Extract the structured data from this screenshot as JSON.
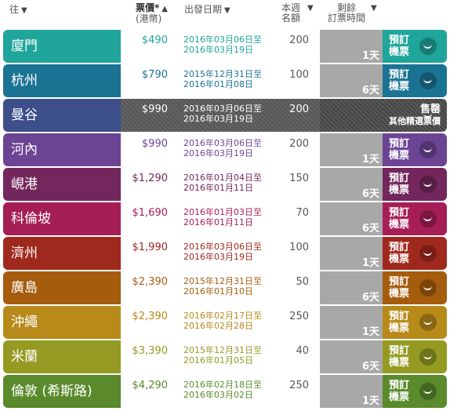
{
  "header": {
    "dest": "往",
    "price_main": "票價*",
    "price_sub": "(港幣)",
    "date": "出發日期",
    "quota_l1": "本週",
    "quota_l2": "名額",
    "remain_l1": "剩餘",
    "remain_l2": "訂票時間",
    "sort_desc": "▼",
    "sort_asc": "▲"
  },
  "rows": [
    {
      "city": "廈門",
      "price": "$490",
      "date1": "2016年03月06日至",
      "date2": "2016年03月19日",
      "quota": "200",
      "days": "1天",
      "book": "預訂機票",
      "color": "#1fa59a",
      "textcolor": "#1fa59a"
    },
    {
      "city": "杭州",
      "price": "$790",
      "date1": "2015年12月31日至",
      "date2": "2016年01月08日",
      "quota": "100",
      "days": "6天",
      "book": "預訂機票",
      "color": "#1b7393",
      "textcolor": "#1b7393"
    },
    {
      "city": "曼谷",
      "price": "$990",
      "date1": "2016年03月06日至",
      "date2": "2016年03月19日",
      "quota": "200",
      "days": "",
      "book": "售罄",
      "book2": "其他精選票價",
      "color": "#3d4f8a",
      "textcolor": "#ffffff"
    },
    {
      "city": "河內",
      "price": "$990",
      "date1": "2016年03月06日至",
      "date2": "2016年03月19日",
      "quota": "200",
      "days": "1天",
      "book": "預訂機票",
      "color": "#6b4494",
      "textcolor": "#6b4494"
    },
    {
      "city": "峴港",
      "price": "$1,290",
      "date1": "2016年01月04日至",
      "date2": "2016年01月11日",
      "quota": "150",
      "days": "6天",
      "book": "預訂機票",
      "color": "#73275c",
      "textcolor": "#73275c"
    },
    {
      "city": "科倫坡",
      "price": "$1,690",
      "date1": "2016年01月03日至",
      "date2": "2016年01月11日",
      "quota": "70",
      "days": "6天",
      "book": "預訂機票",
      "color": "#a61e56",
      "textcolor": "#a61e56"
    },
    {
      "city": "濟州",
      "price": "$1,990",
      "date1": "2016年03月06日至",
      "date2": "2016年03月19日",
      "quota": "100",
      "days": "1天",
      "book": "預訂機票",
      "color": "#a0291e",
      "textcolor": "#a0291e"
    },
    {
      "city": "廣島",
      "price": "$2,390",
      "date1": "2015年12月31日至",
      "date2": "2016年01月10日",
      "quota": "50",
      "days": "6天",
      "book": "預訂機票",
      "color": "#a65c0d",
      "textcolor": "#a65c0d"
    },
    {
      "city": "沖繩",
      "price": "$2,390",
      "date1": "2016年02月17日至",
      "date2": "2016年02月28日",
      "quota": "250",
      "days": "1天",
      "book": "預訂機票",
      "color": "#b78a1a",
      "textcolor": "#b78a1a"
    },
    {
      "city": "米蘭",
      "price": "$3,390",
      "date1": "2015年12月31日至",
      "date2": "2016年01月05日",
      "quota": "40",
      "days": "6天",
      "book": "預訂機票",
      "color": "#949a22",
      "textcolor": "#949a22"
    },
    {
      "city": "倫敦 (希斯路)",
      "price": "$4,290",
      "date1": "2016年02月18日至",
      "date2": "2016年03月02日",
      "quota": "250",
      "days": "1天",
      "book": "預訂機票",
      "color": "#5a8a2c",
      "textcolor": "#5a8a2c"
    }
  ]
}
